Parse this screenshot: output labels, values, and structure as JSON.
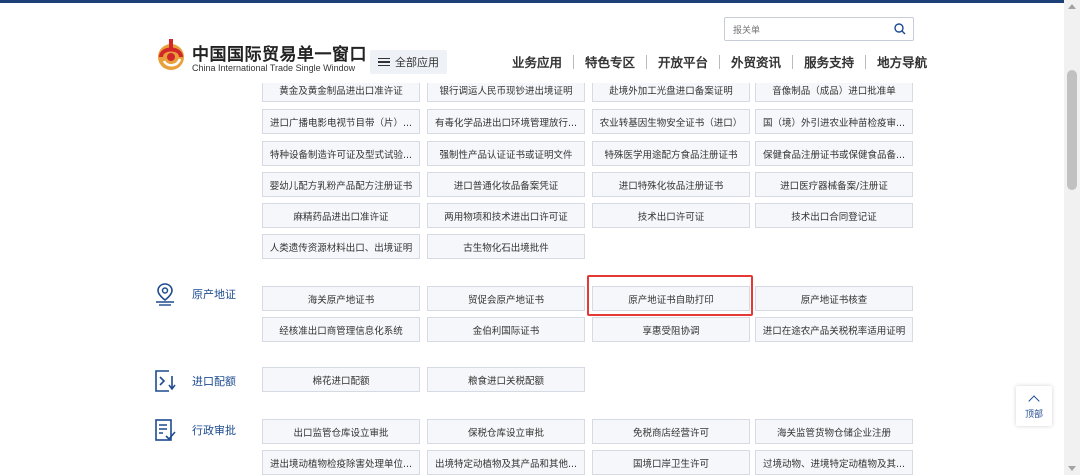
{
  "header": {
    "title": "中国国际贸易单一窗口",
    "subtitle": "China International Trade Single Window",
    "all_apps_label": "全部应用",
    "search_placeholder": "报关单",
    "nav": [
      "业务应用",
      "特色专区",
      "开放平台",
      "外贸资讯",
      "服务支持",
      "地方导航"
    ]
  },
  "sections": {
    "license_rows": [
      [
        "黄金及黄金制品进出口准许证",
        "银行调运人民币现钞进出境证明",
        "赴境外加工光盘进口备案证明",
        "音像制品（成品）进口批准单"
      ],
      [
        "进口广播电影电视节目带（片）...",
        "有毒化学品进出口环境管理放行...",
        "农业转基因生物安全证书（进口）",
        "国（境）外引进农业种苗检疫审..."
      ],
      [
        "特种设备制造许可证及型式试验...",
        "强制性产品认证证书或证明文件",
        "特殊医学用途配方食品注册证书",
        "保健食品注册证书或保健食品备..."
      ],
      [
        "婴幼儿配方乳粉产品配方注册证书",
        "进口普通化妆品备案凭证",
        "进口特殊化妆品注册证书",
        "进口医疗器械备案/注册证"
      ],
      [
        "麻精药品进出口准许证",
        "两用物项和技术进出口许可证",
        "技术出口许可证",
        "技术出口合同登记证"
      ],
      [
        "人类遗传资源材料出口、出境证明",
        "古生物化石出境批件"
      ]
    ],
    "origin": {
      "label": "原产地证",
      "rows": [
        [
          "海关原产地证书",
          "贸促会原产地证书",
          "原产地证书自助打印",
          "原产地证书核查"
        ],
        [
          "经核准出口商管理信息化系统",
          "金伯利国际证书",
          "享惠受阻协调",
          "进口在途农产品关税税率适用证明"
        ]
      ]
    },
    "quota": {
      "label": "进口配额",
      "rows": [
        [
          "棉花进口配额",
          "粮食进口关税配额"
        ]
      ]
    },
    "admin": {
      "label": "行政审批",
      "rows": [
        [
          "出口监管仓库设立审批",
          "保税仓库设立审批",
          "免税商店经营许可",
          "海关监管货物仓储企业注册"
        ],
        [
          "进出境动植物检疫除害处理单位...",
          "出境特定动植物及其产品和其他...",
          "国境口岸卫生许可",
          "过境动物、进境特定动植物及其..."
        ]
      ]
    }
  },
  "to_top_label": "顶部",
  "colors": {
    "accent_blue": "#1d4b8f",
    "highlight_red": "#e53935",
    "button_bg": "#f5f7fa"
  }
}
